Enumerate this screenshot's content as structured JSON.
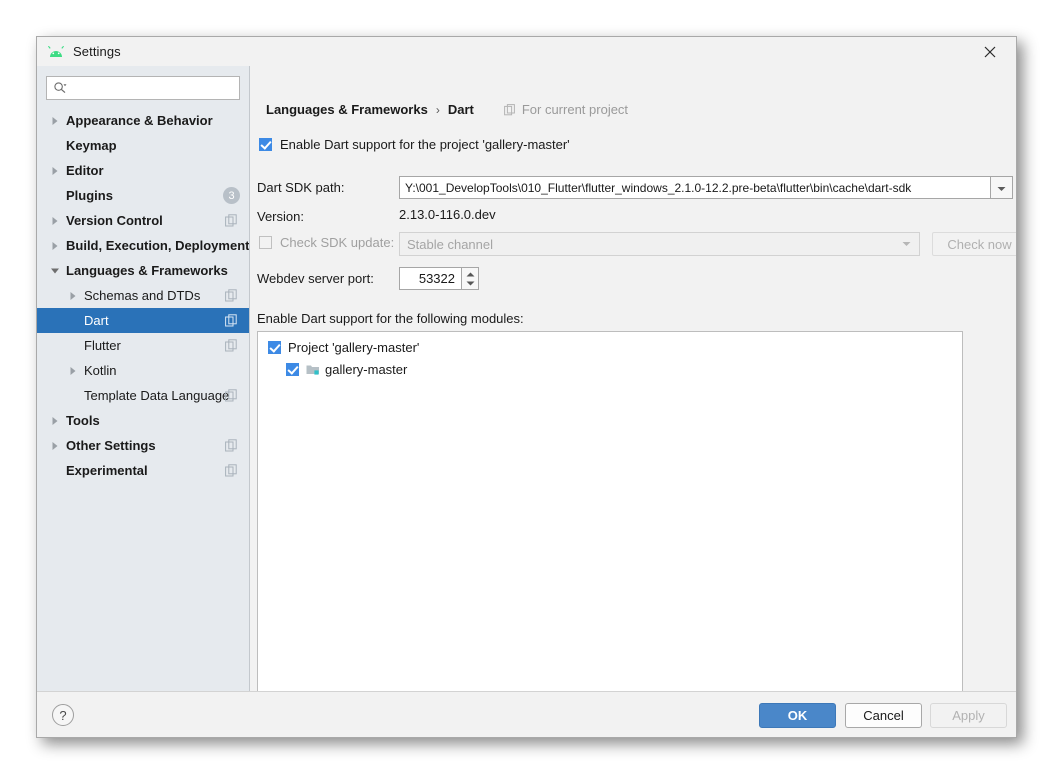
{
  "window": {
    "title": "Settings",
    "icon": "android-logo-icon",
    "close_label": "close-icon"
  },
  "sidebar": {
    "search": {
      "placeholder": "",
      "value": "",
      "icon": "search-icon"
    },
    "items": [
      {
        "label": "Appearance & Behavior",
        "level": 0,
        "bold": true,
        "arrow": "right",
        "icon": null,
        "badge": null,
        "selected": false
      },
      {
        "label": "Keymap",
        "level": 0,
        "bold": true,
        "arrow": null,
        "icon": null,
        "badge": null,
        "selected": false
      },
      {
        "label": "Editor",
        "level": 0,
        "bold": true,
        "arrow": "right",
        "icon": null,
        "badge": null,
        "selected": false
      },
      {
        "label": "Plugins",
        "level": 0,
        "bold": true,
        "arrow": null,
        "icon": null,
        "badge": "3",
        "selected": false
      },
      {
        "label": "Version Control",
        "level": 0,
        "bold": true,
        "arrow": "right",
        "icon": "copy-icon",
        "badge": null,
        "selected": false
      },
      {
        "label": "Build, Execution, Deployment",
        "level": 0,
        "bold": true,
        "arrow": "right",
        "icon": null,
        "badge": null,
        "selected": false
      },
      {
        "label": "Languages & Frameworks",
        "level": 0,
        "bold": true,
        "arrow": "down",
        "icon": null,
        "badge": null,
        "selected": false
      },
      {
        "label": "Schemas and DTDs",
        "level": 1,
        "bold": false,
        "arrow": "right",
        "icon": "copy-icon",
        "badge": null,
        "selected": false
      },
      {
        "label": "Dart",
        "level": 1,
        "bold": false,
        "arrow": null,
        "icon": "copy-icon",
        "badge": null,
        "selected": true
      },
      {
        "label": "Flutter",
        "level": 1,
        "bold": false,
        "arrow": null,
        "icon": "copy-icon",
        "badge": null,
        "selected": false
      },
      {
        "label": "Kotlin",
        "level": 1,
        "bold": false,
        "arrow": "right",
        "icon": null,
        "badge": null,
        "selected": false
      },
      {
        "label": "Template Data Language",
        "level": 1,
        "bold": false,
        "arrow": null,
        "icon": "copy-icon",
        "badge": null,
        "selected": false
      },
      {
        "label": "Tools",
        "level": 0,
        "bold": true,
        "arrow": "right",
        "icon": null,
        "badge": null,
        "selected": false
      },
      {
        "label": "Other Settings",
        "level": 0,
        "bold": true,
        "arrow": "right",
        "icon": "copy-icon",
        "badge": null,
        "selected": false
      },
      {
        "label": "Experimental",
        "level": 0,
        "bold": true,
        "arrow": null,
        "icon": "copy-icon",
        "badge": null,
        "selected": false
      }
    ]
  },
  "main": {
    "breadcrumb": {
      "parent": "Languages & Frameworks",
      "separator": "›",
      "current": "Dart",
      "scope_label": "For current project",
      "scope_icon": "copy-icon"
    },
    "enable_dart": {
      "label": "Enable Dart support for the project 'gallery-master'",
      "checked": true
    },
    "sdk_path": {
      "label": "Dart SDK path:",
      "value": "Y:\\001_DevelopTools\\010_Flutter\\flutter_windows_2.1.0-12.2.pre-beta\\flutter\\bin\\cache\\dart-sdk",
      "dropdown_icon": "chevron-down-icon",
      "browse_label": ""
    },
    "version": {
      "label": "Version:",
      "value": "2.13.0-116.0.dev"
    },
    "check_sdk_update": {
      "label": "Check SDK update:",
      "checked": false,
      "channel_value": "Stable channel",
      "channel_dropdown_icon": "chevron-down-icon",
      "check_now_label": "Check now"
    },
    "webdev_port": {
      "label": "Webdev server port:",
      "value": "53322",
      "up_icon": "stepper-up-icon",
      "down_icon": "stepper-down-icon"
    },
    "modules": {
      "label": "Enable Dart support for the following modules:",
      "rows": [
        {
          "label": "Project 'gallery-master'",
          "checked": true,
          "level": 0,
          "icon": null
        },
        {
          "label": "gallery-master",
          "checked": true,
          "level": 1,
          "icon": "module-folder-icon"
        }
      ]
    }
  },
  "footer": {
    "help_label": "?",
    "ok_label": "OK",
    "cancel_label": "Cancel",
    "apply_label": "Apply"
  },
  "colors": {
    "accent_blue": "#2a72b8",
    "checkbox_blue": "#3d8ae5",
    "ok_button": "#4a87c9",
    "sidebar_bg": "#e6eaee",
    "panel_bg": "#f2f2f2",
    "android_green": "#3ddc84"
  }
}
